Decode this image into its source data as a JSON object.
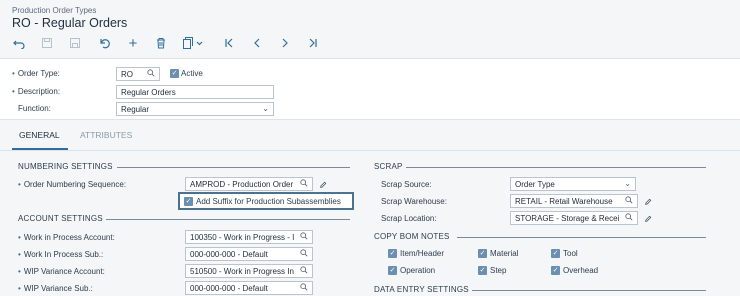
{
  "header": {
    "breadcrumb": "Production Order Types",
    "title": "RO - Regular Orders"
  },
  "toolbar": {
    "undo": "undo-icon",
    "save_close": "save-close-icon",
    "save": "save-icon",
    "cancel": "cancel-icon",
    "add": "+",
    "delete": "delete-icon",
    "copy_paste": "copy-paste-icon",
    "first": "first-icon",
    "prev": "previous-icon",
    "next": "next-icon",
    "last": "last-icon"
  },
  "form": {
    "order_type_label": "Order Type:",
    "order_type_value": "RO",
    "active_label": "Active",
    "active_checked": true,
    "description_label": "Description:",
    "description_value": "Regular Orders",
    "function_label": "Function:",
    "function_value": "Regular"
  },
  "tabs": [
    {
      "label": "GENERAL",
      "active": true
    },
    {
      "label": "ATTRIBUTES",
      "active": false
    }
  ],
  "numbering": {
    "title": "NUMBERING SETTINGS",
    "sequence_label": "Order Numbering Sequence:",
    "sequence_value": "AMPROD - Production Order",
    "suffix_label": "Add Suffix for Production Subassemblies",
    "suffix_checked": true
  },
  "account": {
    "title": "ACCOUNT SETTINGS",
    "rows": [
      {
        "label": "Work in Process Account:",
        "value": "100350 - Work in Progress - I"
      },
      {
        "label": "Work In Process Sub.:",
        "value": "000-000-000 - Default"
      },
      {
        "label": "WIP Variance Account:",
        "value": "510500 - Work in Progress In"
      },
      {
        "label": "WIP Variance Sub.:",
        "value": "000-000-000 - Default"
      }
    ]
  },
  "scrap": {
    "title": "SCRAP",
    "source_label": "Scrap Source:",
    "source_value": "Order Type",
    "warehouse_label": "Scrap Warehouse:",
    "warehouse_value": "RETAIL - Retail Warehouse",
    "location_label": "Scrap Location:",
    "location_value": "STORAGE - Storage & Recei"
  },
  "bom_notes": {
    "title": "COPY BOM NOTES",
    "items": [
      {
        "label": "Item/Header",
        "checked": true
      },
      {
        "label": "Material",
        "checked": true
      },
      {
        "label": "Tool",
        "checked": true
      },
      {
        "label": "Operation",
        "checked": true
      },
      {
        "label": "Step",
        "checked": true
      },
      {
        "label": "Overhead",
        "checked": true
      }
    ]
  },
  "data_entry": {
    "title": "DATA ENTRY SETTINGS"
  },
  "colors": {
    "accent": "#2f6e9e",
    "checkbox": "#6b8fb0",
    "highlight_border": "#4b7390"
  }
}
